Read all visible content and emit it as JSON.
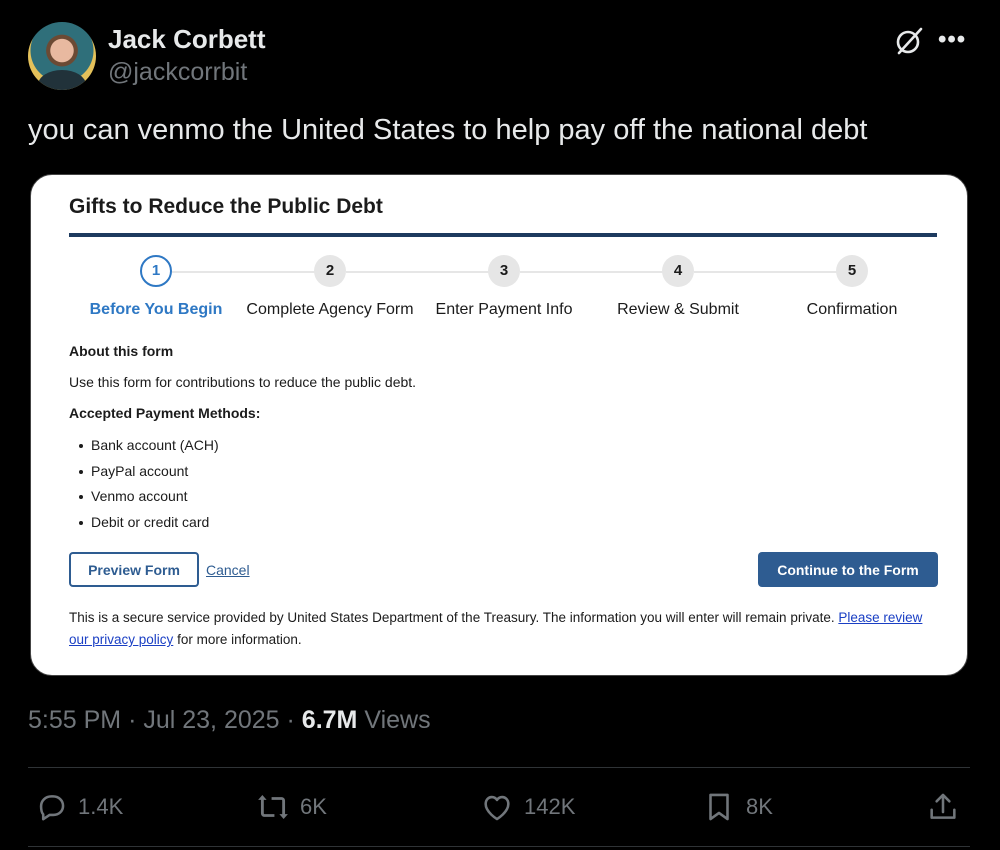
{
  "author": {
    "name": "Jack Corbett",
    "handle": "@jackcorrbit"
  },
  "header_icons": {
    "grok": "grok-icon",
    "more": "more-icon",
    "more_glyph": "•••"
  },
  "tweet": {
    "text": "you can venmo the United States to help pay off the national debt"
  },
  "form": {
    "title": "Gifts to Reduce the Public Debt",
    "steps": [
      {
        "number": "1",
        "label": "Before You Begin",
        "active": true
      },
      {
        "number": "2",
        "label": "Complete Agency Form",
        "active": false
      },
      {
        "number": "3",
        "label": "Enter Payment Info",
        "active": false
      },
      {
        "number": "4",
        "label": "Review & Submit",
        "active": false
      },
      {
        "number": "5",
        "label": "Confirmation",
        "active": false
      }
    ],
    "about_heading": "About this form",
    "about_text": "Use this form for contributions to reduce the public debt.",
    "methods_heading": "Accepted Payment Methods:",
    "methods": [
      "Bank account (ACH)",
      "PayPal account",
      "Venmo account",
      "Debit or credit card"
    ],
    "preview_label": "Preview Form",
    "cancel_label": "Cancel",
    "continue_label": "Continue to the Form",
    "secure_text": "This is a secure service provided by United States Department of the Treasury. The information you will enter will remain private.",
    "privacy_link": "Please review our privacy policy",
    "secure_suffix": "for more information.",
    "colors": {
      "accent": "#2e5c91",
      "active_step": "#2e78c4",
      "rule": "#1d3a5f"
    }
  },
  "meta": {
    "time": "5:55 PM",
    "date": "Jul 23, 2025",
    "views_count": "6.7M",
    "views_label": "Views"
  },
  "actions": {
    "replies": "1.4K",
    "reposts": "6K",
    "likes": "142K",
    "bookmarks": "8K"
  }
}
